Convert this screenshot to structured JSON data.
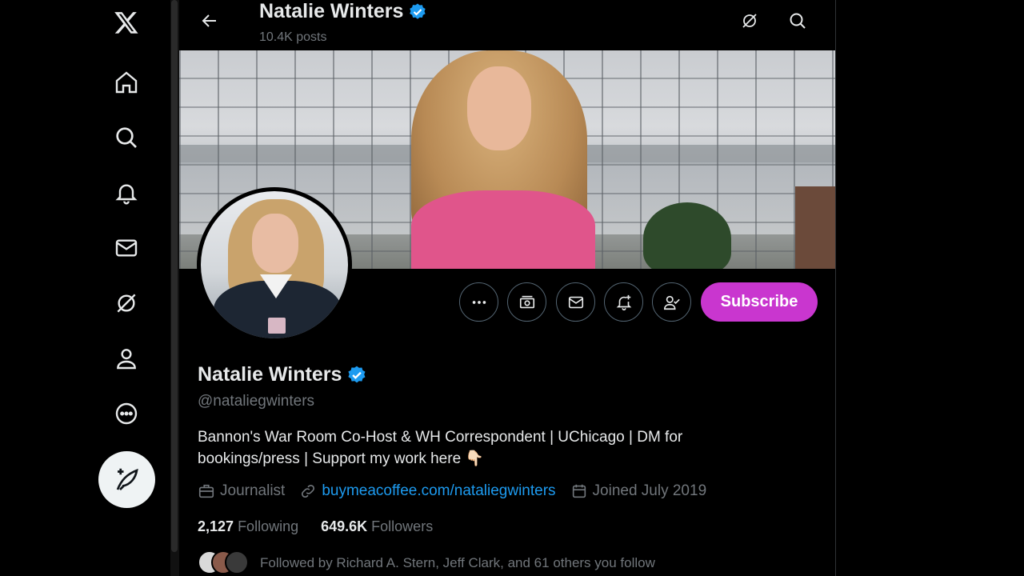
{
  "nav": {
    "items": [
      {
        "name": "x-logo-icon"
      },
      {
        "name": "home-icon"
      },
      {
        "name": "search-icon"
      },
      {
        "name": "notifications-icon"
      },
      {
        "name": "messages-icon"
      },
      {
        "name": "grok-icon"
      },
      {
        "name": "profile-icon"
      },
      {
        "name": "more-icon"
      }
    ],
    "compose_icon": "compose-post-icon"
  },
  "header": {
    "name": "Natalie Winters",
    "posts": "10.4K posts"
  },
  "profile": {
    "name": "Natalie Winters",
    "handle": "@nataliegwinters",
    "bio_line1": "Bannon's War Room Co-Host & WH Correspondent | UChicago | DM for",
    "bio_line2": "bookings/press | Support my work here 👇🏻",
    "category": "Journalist",
    "website": "buymeacoffee.com/nataliegwinters",
    "joined": "Joined July 2019",
    "following_count": "2,127",
    "following_label": "Following",
    "followers_count": "649.6K",
    "followers_label": "Followers",
    "followed_by": "Followed by Richard A. Stern, Jeff Clark, and 61 others you follow"
  },
  "actions": {
    "subscribe_label": "Subscribe"
  },
  "colors": {
    "accent": "#1d9bf0",
    "subscribe": "#c936cf",
    "verified": "#1d9bf0",
    "muted": "#71767b"
  }
}
